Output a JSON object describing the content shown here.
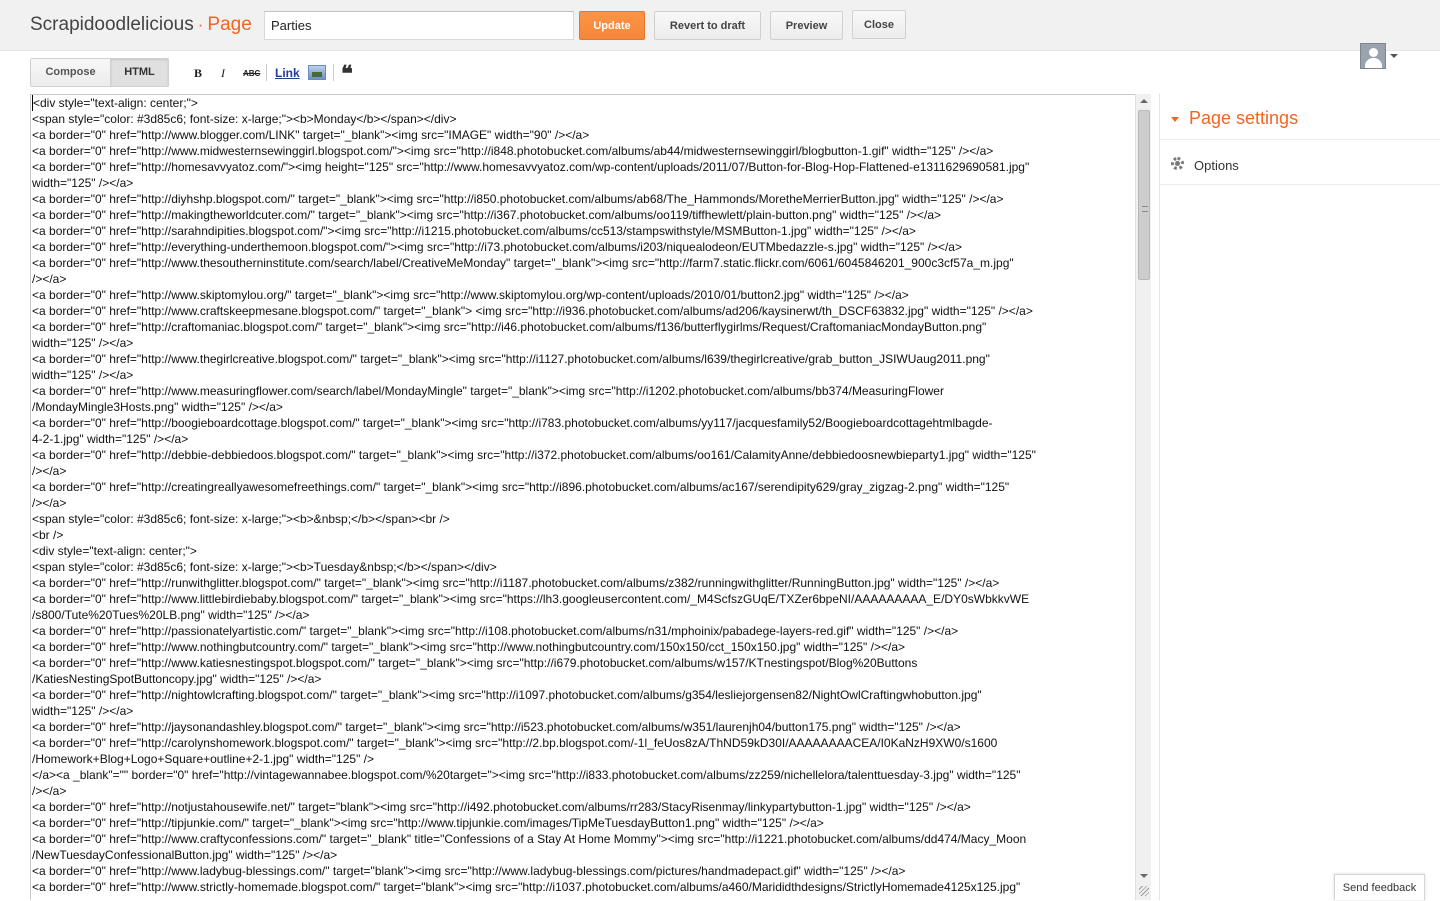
{
  "header": {
    "blog_name": "Scrapidoodlelicious",
    "separator": "·",
    "kind": "Page",
    "title_value": "Parties",
    "update_label": "Update",
    "revert_label": "Revert to draft",
    "preview_label": "Preview",
    "close_label": "Close"
  },
  "toolbar": {
    "compose_label": "Compose",
    "html_label": "HTML",
    "bold_label": "B",
    "italic_label": "I",
    "strike_label": "ABC",
    "link_label": "Link",
    "quote_label": "❝"
  },
  "icons": {
    "bold": "bold-icon",
    "italic": "italic-icon",
    "strike": "strikethrough-icon",
    "image": "image-icon",
    "quote": "quote-icon",
    "avatar": "avatar-icon",
    "gear": "gear-icon"
  },
  "colors": {
    "accent": "#f26522",
    "update_button": "#f5863a"
  },
  "sidebar": {
    "title": "Page settings",
    "options_label": "Options"
  },
  "feedback_label": "Send feedback",
  "editor": {
    "lines": [
      "<div style=\"text-align: center;\">",
      "<span style=\"color: #3d85c6; font-size: x-large;\"><b>Monday</b></span></div>",
      "<a border=\"0\" href=\"http://www.blogger.com/LINK\" target=\"_blank\"><img src=\"IMAGE\" width=\"90\" /></a>",
      "<a border=\"0\" href=\"http://www.midwesternsewinggirl.blogspot.com/\"><img src=\"http://i848.photobucket.com/albums/ab44/midwesternsewinggirl/blogbutton-1.gif\" width=\"125\" /></a>",
      "<a border=\"0\" href=\"http://homesavvyatoz.com/\"><img height=\"125\" src=\"http://www.homesavvyatoz.com/wp-content/uploads/2011/07/Button-for-Blog-Hop-Flattened-e1311629690581.jpg\"",
      "width=\"125\" /></a>",
      "<a border=\"0\" href=\"http://diyhshp.blogspot.com/\" target=\"_blank\"><img src=\"http://i850.photobucket.com/albums/ab68/The_Hammonds/MoretheMerrierButton.jpg\" width=\"125\" /></a>",
      "<a border=\"0\" href=\"http://makingtheworldcuter.com/\" target=\"_blank\"><img src=\"http://i367.photobucket.com/albums/oo119/tiffhewlett/plain-button.png\" width=\"125\" /></a>",
      "<a border=\"0\" href=\"http://sarahndipities.blogspot.com/\"><img src=\"http://i1215.photobucket.com/albums/cc513/stampswithstyle/MSMButton-1.jpg\" width=\"125\" /></a>",
      "<a border=\"0\" href=\"http://everything-underthemoon.blogspot.com/\"><img src=\"http://i73.photobucket.com/albums/i203/niquealodeon/EUTMbedazzle-s.jpg\" width=\"125\" /></a>",
      "<a border=\"0\" href=\"http://www.thesoutherninstitute.com/search/label/CreativeMeMonday\" target=\"_blank\"><img src=\"http://farm7.static.flickr.com/6061/6045846201_900c3cf57a_m.jpg\"",
      "/></a>",
      "<a border=\"0\" href=\"http://www.skiptomylou.org/\" target=\"_blank\"><img src=\"http://www.skiptomylou.org/wp-content/uploads/2010/01/button2.jpg\" width=\"125\" /></a>",
      "<a border=\"0\" href=\"http://www.craftskeepmesane.blogspot.com/\" target=\"_blank\"> <img src=\"http://i936.photobucket.com/albums/ad206/kaysinerwt/th_DSCF63832.jpg\" width=\"125\" /></a>",
      "<a border=\"0\" href=\"http://craftomaniac.blogspot.com/\" target=\"_blank\"><img src=\"http://i46.photobucket.com/albums/f136/butterflygirlms/Request/CraftomaniacMondayButton.png\"",
      "width=\"125\" /></a>",
      "<a border=\"0\" href=\"http://www.thegirlcreative.blogspot.com/\" target=\"_blank\"><img src=\"http://i1127.photobucket.com/albums/l639/thegirlcreative/grab_button_JSIWUaug2011.png\"",
      "width=\"125\" /></a>",
      "<a border=\"0\" href=\"http://www.measuringflower.com/search/label/MondayMingle\" target=\"_blank\"><img src=\"http://i1202.photobucket.com/albums/bb374/MeasuringFlower",
      "/MondayMingle3Hosts.png\" width=\"125\" /></a>",
      "<a border=\"0\" href=\"http://boogieboardcottage.blogspot.com/\" target=\"_blank\"><img src=\"http://i783.photobucket.com/albums/yy117/jacquesfamily52/Boogieboardcottagehtmlbagde-",
      "4-2-1.jpg\" width=\"125\" /></a>",
      "<a border=\"0\" href=\"http://debbie-debbiedoos.blogspot.com/\" target=\"_blank\"><img src=\"http://i372.photobucket.com/albums/oo161/CalamityAnne/debbiedoosnewbieparty1.jpg\" width=\"125\"",
      "/></a>",
      "<a border=\"0\" href=\"http://creatingreallyawesomefreethings.com/\" target=\"_blank\"><img src=\"http://i896.photobucket.com/albums/ac167/serendipity629/gray_zigzag-2.png\" width=\"125\"",
      "/></a>",
      "<span style=\"color: #3d85c6; font-size: x-large;\"><b>&nbsp;</b></span><br />",
      "<br />",
      "<div style=\"text-align: center;\">",
      "<span style=\"color: #3d85c6; font-size: x-large;\"><b>Tuesday&nbsp;</b></span></div>",
      "<a border=\"0\" href=\"http://runwithglitter.blogspot.com/\" target=\"_blank\"><img src=\"http://i1187.photobucket.com/albums/z382/runningwithglitter/RunningButton.jpg\" width=\"125\" /></a>",
      "<a border=\"0\" href=\"http://www.littlebirdiebaby.blogspot.com/\" target=\"_blank\"><img src=\"https://lh3.googleusercontent.com/_M4ScfszGUqE/TXZer6bpeNI/AAAAAAAAA_E/DY0sWbkkvWE",
      "/s800/Tute%20Tues%20LB.png\" width=\"125\" /></a>",
      "<a border=\"0\" href=\"http://passionatelyartistic.com/\" target=\"_blank\"><img src=\"http://i108.photobucket.com/albums/n31/mphoinix/pabadege-layers-red.gif\" width=\"125\" /></a>",
      "<a border=\"0\" href=\"http://www.nothingbutcountry.com/\" target=\"_blank\"><img src=\"http://www.nothingbutcountry.com/150x150/cct_150x150.jpg\" width=\"125\" /></a>",
      "<a border=\"0\" href=\"http://www.katiesnestingspot.blogspot.com/\" target=\"_blank\"><img src=\"http://i679.photobucket.com/albums/w157/KTnestingspot/Blog%20Buttons",
      "/KatiesNestingSpotButtoncopy.jpg\" width=\"125\" /></a>",
      "<a border=\"0\" href=\"http://nightowlcrafting.blogspot.com/\" target=\"_blank\"><img src=\"http://i1097.photobucket.com/albums/g354/lesliejorgensen82/NightOwlCraftingwhobutton.jpg\"",
      "width=\"125\" /></a>",
      "<a border=\"0\" href=\"http://jaysonandashley.blogspot.com/\" target=\"_blank\"><img src=\"http://i523.photobucket.com/albums/w351/laurenjh04/button175.png\" width=\"125\" /></a>",
      "<a border=\"0\" href=\"http://carolynshomework.blogspot.com/\" target=\"_blank\"><img src=\"http://2.bp.blogspot.com/-1l_feUos8zA/ThND59kD30I/AAAAAAAACEA/I0KaNzH9XW0/s1600",
      "/Homework+Blog+Logo+Square+outline+2-1.jpg\" width=\"125\" />",
      "</a><a _blank\"=\"\" border=\"0\" href=\"http://vintagewannabee.blogspot.com/%20target=\"><img src=\"http://i833.photobucket.com/albums/zz259/nichellelora/talenttuesday-3.jpg\" width=\"125\"",
      "/></a>",
      "<a border=\"0\" href=\"http://notjustahousewife.net/\" target=\"blank\"><img src=\"http://i492.photobucket.com/albums/rr283/StacyRisenmay/linkypartybutton-1.jpg\" width=\"125\" /></a>",
      "<a border=\"0\" href=\"http://tipjunkie.com/\" target=\"_blank\"><img src=\"http://www.tipjunkie.com/images/TipMeTuesdayButton1.png\" width=\"125\" /></a>",
      "<a border=\"0\" href=\"http://www.craftyconfessions.com/\" target=\"_blank\" title=\"Confessions of a Stay At Home Mommy\"><img src=\"http://i1221.photobucket.com/albums/dd474/Macy_Moon",
      "/NewTuesdayConfessionalButton.jpg\" width=\"125\" /></a>",
      "<a border=\"0\" href=\"http://www.ladybug-blessings.com/\" target=\"blank\"><img src=\"http://www.ladybug-blessings.com/pictures/handmadepact.gif\" width=\"125\" /></a>",
      "<a border=\"0\" href=\"http://www.strictly-homemade.blogspot.com/\" target=\"blank\"><img src=\"http://i1037.photobucket.com/albums/a460/Marididthdesigns/StrictlyHomemade4125x125.jpg\""
    ]
  }
}
